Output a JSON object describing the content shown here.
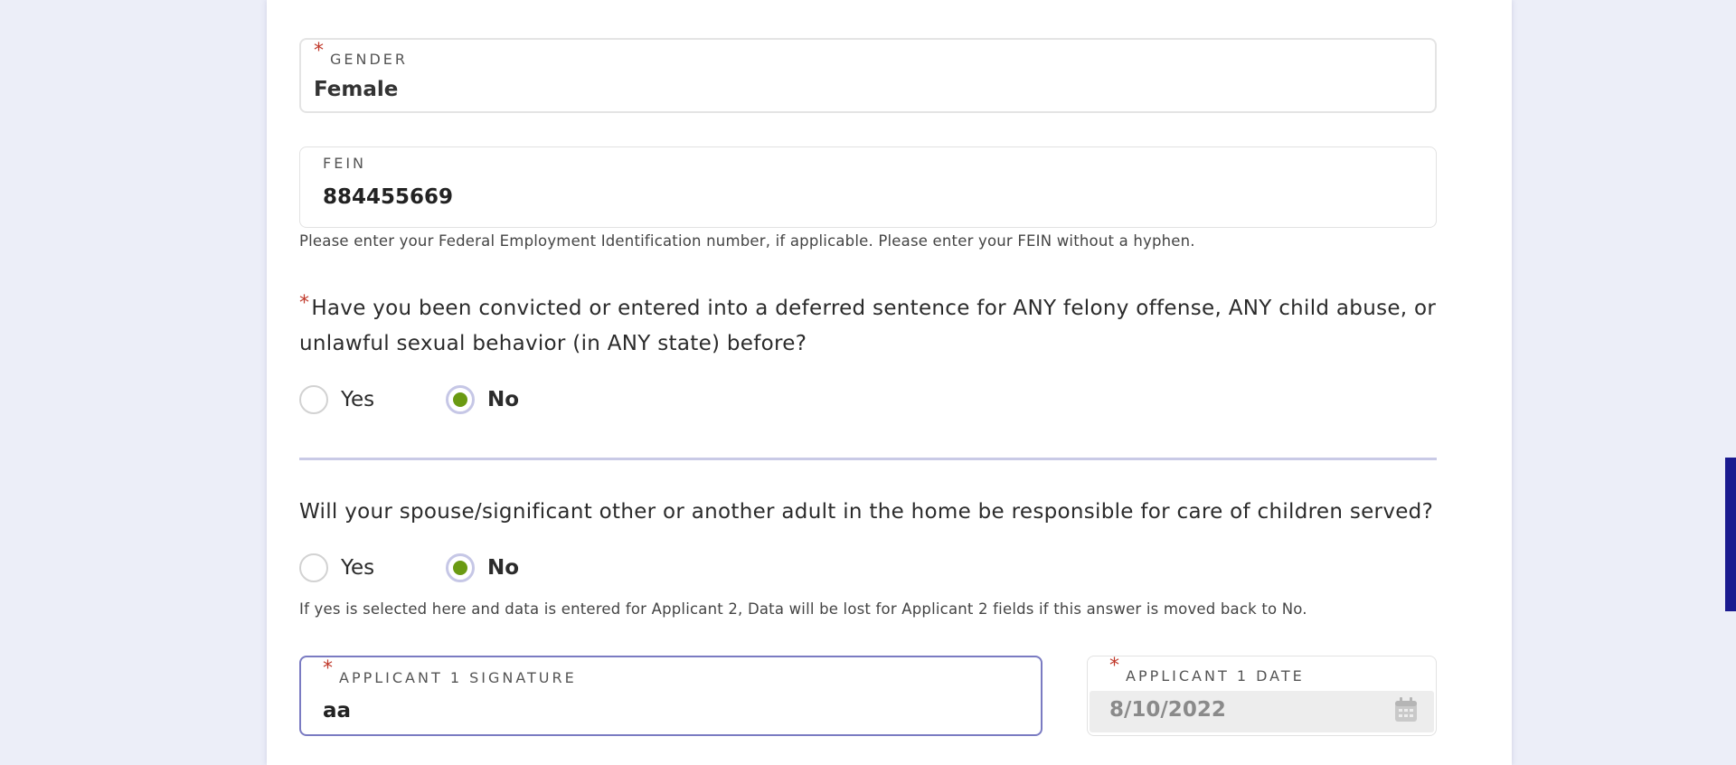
{
  "top_cut_text": "…, …                                                    …",
  "gender": {
    "label": "Gender",
    "value": "Female"
  },
  "fein": {
    "label": "FEIN",
    "value": "884455669",
    "help": "Please enter your Federal Employment Identification number, if applicable. Please enter your FEIN without a hyphen."
  },
  "q_felony": {
    "line1": "Have you been convicted or entered into a deferred sentence for ANY felony offense, ANY child abuse, or",
    "line2": "unlawful sexual behavior (in ANY state) before?",
    "yes_label": "Yes",
    "no_label": "No",
    "selected": "No"
  },
  "q_spouse": {
    "text": "Will your spouse/significant other or another adult in the home be responsible for care of children served?",
    "yes_label": "Yes",
    "no_label": "No",
    "selected": "No",
    "help": "If yes is selected here and data is entered for Applicant 2, Data will be lost for Applicant 2 fields if this answer is moved back to No."
  },
  "signature": {
    "label": "Applicant 1 Signature",
    "value": "aa"
  },
  "date": {
    "label": "Applicant 1 Date",
    "value": "8/10/2022"
  },
  "required_marker": "*",
  "colors": {
    "accent_green": "#6a9a12",
    "focus_border": "#7a7bc2",
    "required_red": "#c0392b",
    "scrollbar": "#1a1a8f"
  }
}
